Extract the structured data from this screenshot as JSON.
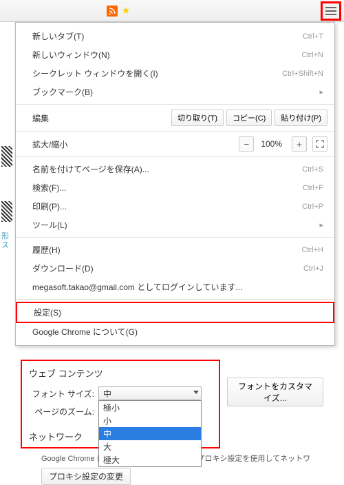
{
  "toolbar": {
    "rss_icon": "rss-icon",
    "star_icon": "star-icon"
  },
  "menu": {
    "new_tab": "新しいタブ(T)",
    "new_tab_sc": "Ctrl+T",
    "new_window": "新しいウィンドウ(N)",
    "new_window_sc": "Ctrl+N",
    "incognito": "シークレット ウィンドウを開く(I)",
    "incognito_sc": "Ctrl+Shift+N",
    "bookmarks": "ブックマーク(B)",
    "edit": "編集",
    "cut": "切り取り(T)",
    "copy": "コピー(C)",
    "paste": "貼り付け(P)",
    "zoom": "拡大/縮小",
    "zoom_minus": "−",
    "zoom_value": "100%",
    "zoom_plus": "+",
    "save_as": "名前を付けてページを保存(A)...",
    "save_as_sc": "Ctrl+S",
    "find": "検索(F)...",
    "find_sc": "Ctrl+F",
    "print": "印刷(P)...",
    "print_sc": "Ctrl+P",
    "tools": "ツール(L)",
    "history": "履歴(H)",
    "history_sc": "Ctrl+H",
    "downloads": "ダウンロード(D)",
    "downloads_sc": "Ctrl+J",
    "login": "megasoft.takao@gmail.com としてログインしています...",
    "settings": "設定(S)",
    "about": "Google Chrome について(G)"
  },
  "settings": {
    "web_content": "ウェブ コンテンツ",
    "font_size_label": "フォント サイズ:",
    "font_size_value": "中",
    "options": {
      "xs": "極小",
      "s": "小",
      "m": "中",
      "l": "大",
      "xl": "極大"
    },
    "page_zoom_label": "ページのズーム:",
    "customize": "フォントをカスタマイズ...",
    "network": "ネットワーク",
    "network_desc": "Google Chrome は、コンピュータのシステム プロキシ設定を使用してネットワ",
    "proxy_btn": "プロキシ設定の変更"
  },
  "side": {
    "text": "形ス"
  }
}
